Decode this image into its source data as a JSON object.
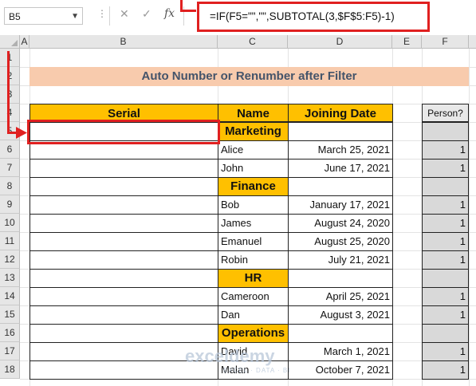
{
  "formula_bar": {
    "name_box": "B5",
    "cancel_icon": "✕",
    "enter_icon": "✓",
    "fx_label": "fx",
    "formula": "=IF(F5=\"\",\"\",SUBTOTAL(3,$F$5:F5)-1)"
  },
  "columns": [
    "A",
    "B",
    "C",
    "D",
    "E",
    "F"
  ],
  "rows": [
    "1",
    "2",
    "3",
    "4",
    "5",
    "6",
    "7",
    "8",
    "9",
    "10",
    "11",
    "12",
    "13",
    "14",
    "15",
    "16",
    "17",
    "18"
  ],
  "sheet": {
    "title": "Auto Number or Renumber after Filter",
    "headers": {
      "serial": "Serial",
      "name": "Name",
      "joining_date": "Joining Date",
      "person": "Person?"
    },
    "data_rows": [
      {
        "row": 5,
        "name": "Marketing",
        "date": "",
        "person": "",
        "is_dept": true
      },
      {
        "row": 6,
        "name": "Alice",
        "date": "March 25, 2021",
        "person": "1",
        "is_dept": false
      },
      {
        "row": 7,
        "name": "John",
        "date": "June 17, 2021",
        "person": "1",
        "is_dept": false
      },
      {
        "row": 8,
        "name": "Finance",
        "date": "",
        "person": "",
        "is_dept": true
      },
      {
        "row": 9,
        "name": "Bob",
        "date": "January 17, 2021",
        "person": "1",
        "is_dept": false
      },
      {
        "row": 10,
        "name": "James",
        "date": "August 24, 2020",
        "person": "1",
        "is_dept": false
      },
      {
        "row": 11,
        "name": "Emanuel",
        "date": "August 25, 2020",
        "person": "1",
        "is_dept": false
      },
      {
        "row": 12,
        "name": "Robin",
        "date": "July 21, 2021",
        "person": "1",
        "is_dept": false
      },
      {
        "row": 13,
        "name": "HR",
        "date": "",
        "person": "",
        "is_dept": true
      },
      {
        "row": 14,
        "name": "Cameroon",
        "date": "April 25, 2021",
        "person": "1",
        "is_dept": false
      },
      {
        "row": 15,
        "name": "Dan",
        "date": "August 3, 2021",
        "person": "1",
        "is_dept": false
      },
      {
        "row": 16,
        "name": "Operations",
        "date": "",
        "person": "",
        "is_dept": true
      },
      {
        "row": 17,
        "name": "David",
        "date": "March 1, 2021",
        "person": "1",
        "is_dept": false
      },
      {
        "row": 18,
        "name": "Malan",
        "date": "October 7, 2021",
        "person": "1",
        "is_dept": false
      }
    ]
  },
  "watermark": {
    "brand": "exceldemy",
    "tagline": "EXCEL · DATA · BI"
  },
  "colors": {
    "title_fill": "#f8cbad",
    "header_fill": "#ffc000",
    "highlight": "#e02020",
    "person_fill": "#d9d9d9"
  }
}
